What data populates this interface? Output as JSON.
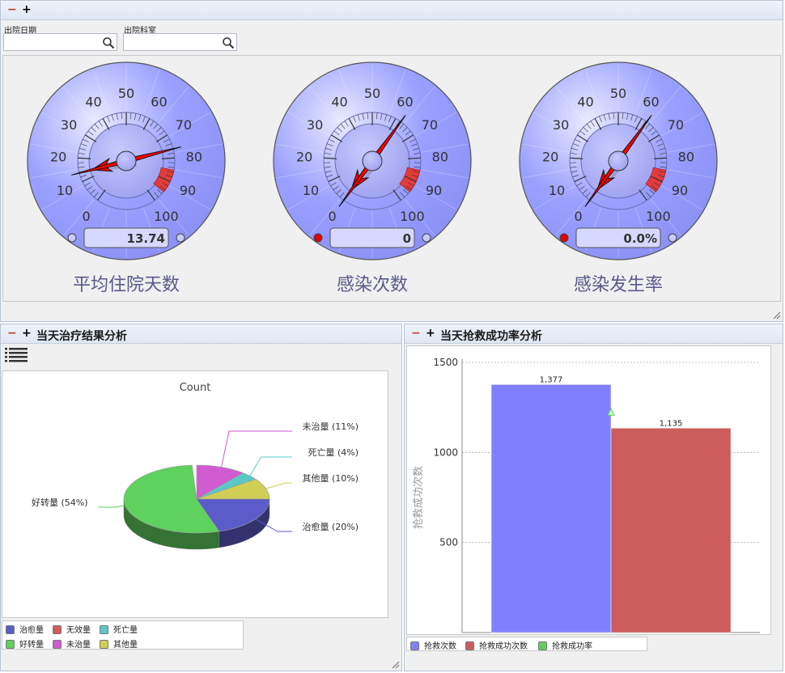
{
  "top_panel": {
    "filters": [
      {
        "label": "出院日期",
        "value": "",
        "placeholder": ""
      },
      {
        "label": "出院科室",
        "value": "",
        "placeholder": ""
      }
    ],
    "gauges": [
      {
        "title": "平均住院天数",
        "value": 13.74,
        "display": "13.74",
        "left_lamp": "off",
        "right_lamp": "off"
      },
      {
        "title": "感染次数",
        "value": 0,
        "display": "0",
        "left_lamp": "red",
        "right_lamp": "off"
      },
      {
        "title": "感染发生率",
        "value": 0,
        "display": "0.0%",
        "left_lamp": "red",
        "right_lamp": "off"
      }
    ],
    "gauge_scale": {
      "ticks": [
        "0",
        "10",
        "20",
        "30",
        "40",
        "50",
        "60",
        "70",
        "80",
        "90",
        "100"
      ],
      "min": 0,
      "max": 100,
      "danger_from": 85,
      "danger_to": 95,
      "danger_color": "#e23b3b",
      "face_color": "#9aa0ff",
      "needle_color": "#ff0000"
    }
  },
  "left_panel": {
    "title": "当天治疗结果分析",
    "minus": "−",
    "plus": "+"
  },
  "right_panel": {
    "title": "当天抢救成功率分析",
    "minus": "−",
    "plus": "+"
  },
  "top_tools": {
    "minus": "−",
    "plus": "+"
  },
  "chart_data": [
    {
      "type": "pie",
      "title": "Count",
      "slices": [
        {
          "name": "治愈量",
          "percent": 20,
          "label": "治愈量 (20%)",
          "color": "#5b5bc9"
        },
        {
          "name": "无效量",
          "percent": 0,
          "label": "",
          "color": "#d15b5b"
        },
        {
          "name": "死亡量",
          "percent": 4,
          "label": "死亡量 (4%)",
          "color": "#5bc8c8"
        },
        {
          "name": "好转量",
          "percent": 54,
          "label": "好转量 (54%)",
          "color": "#5fd15f"
        },
        {
          "name": "未治量",
          "percent": 11,
          "label": "未治量 (11%)",
          "color": "#d15bd1"
        },
        {
          "name": "其他量",
          "percent": 10,
          "label": "其他量 (10%)",
          "color": "#cfcf56"
        }
      ],
      "legend": [
        "治愈量",
        "无效量",
        "死亡量",
        "好转量",
        "未治量",
        "其他量"
      ]
    },
    {
      "type": "bar",
      "categories": [
        "抢救次数",
        "抢救成功次数"
      ],
      "series": [
        {
          "name": "抢救次数",
          "values": [
            1377
          ],
          "color": "#8080ff"
        },
        {
          "name": "抢救成功次数",
          "values": [
            1135
          ],
          "color": "#cd5c5c"
        },
        {
          "name": "抢救成功率",
          "values": [],
          "color": "#5fd15f"
        }
      ],
      "value_labels": [
        "1,377",
        "1,135"
      ],
      "ylabel": "抢救成功次数",
      "yticks": [
        "500",
        "1000",
        "1500"
      ],
      "ylim": [
        0,
        1500
      ],
      "grid": true,
      "legend": [
        "抢救次数",
        "抢救成功次数",
        "抢救成功率"
      ]
    }
  ]
}
